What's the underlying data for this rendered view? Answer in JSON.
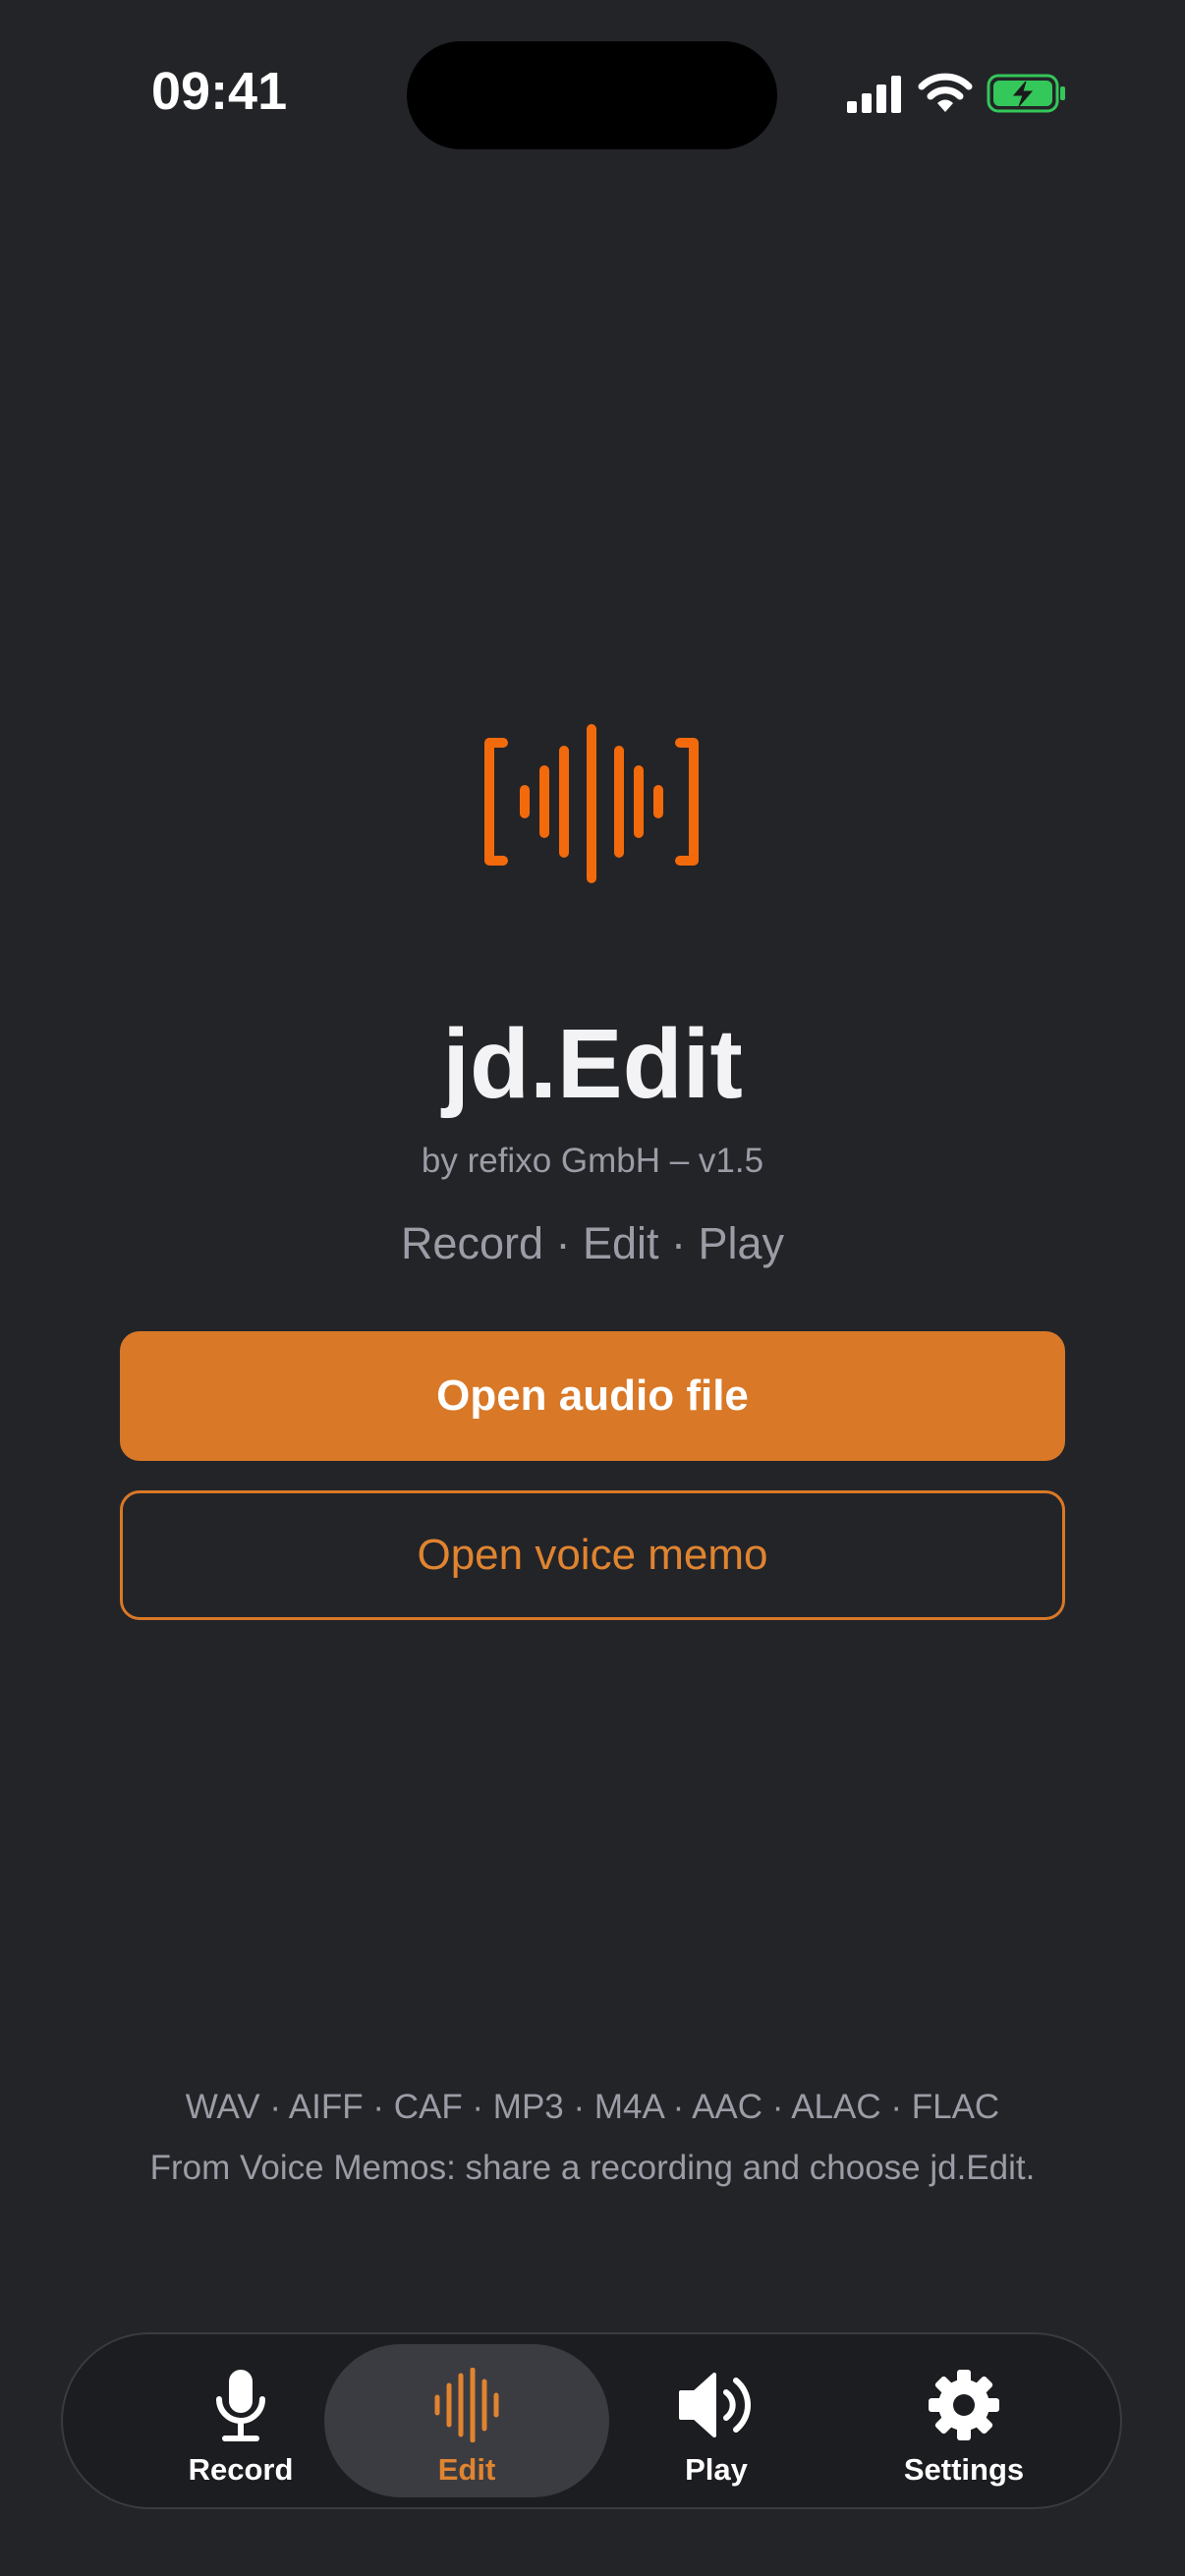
{
  "status_bar": {
    "time": "09:41"
  },
  "colors": {
    "accent": "#d97827",
    "background": "#232428",
    "secondary_text": "#9c9ca6",
    "battery": "#34c759"
  },
  "app": {
    "logo_icon": "waveform-bracket-icon",
    "title": "jd.Edit",
    "byline": "by refixo GmbH – v1.5",
    "tagline": "Record · Edit · Play"
  },
  "actions": {
    "open_audio_file": "Open audio file",
    "open_voice_memo": "Open voice memo"
  },
  "info": {
    "formats": "WAV · AIFF · CAF · MP3 · M4A · AAC · ALAC · FLAC",
    "hint": "From Voice Memos: share a recording and choose jd.Edit."
  },
  "tab_bar": {
    "selected": "Edit",
    "tabs": [
      {
        "label": "Record",
        "icon": "microphone-icon"
      },
      {
        "label": "Edit",
        "icon": "waveform-icon"
      },
      {
        "label": "Play",
        "icon": "speaker-icon"
      },
      {
        "label": "Settings",
        "icon": "gear-icon"
      }
    ]
  }
}
